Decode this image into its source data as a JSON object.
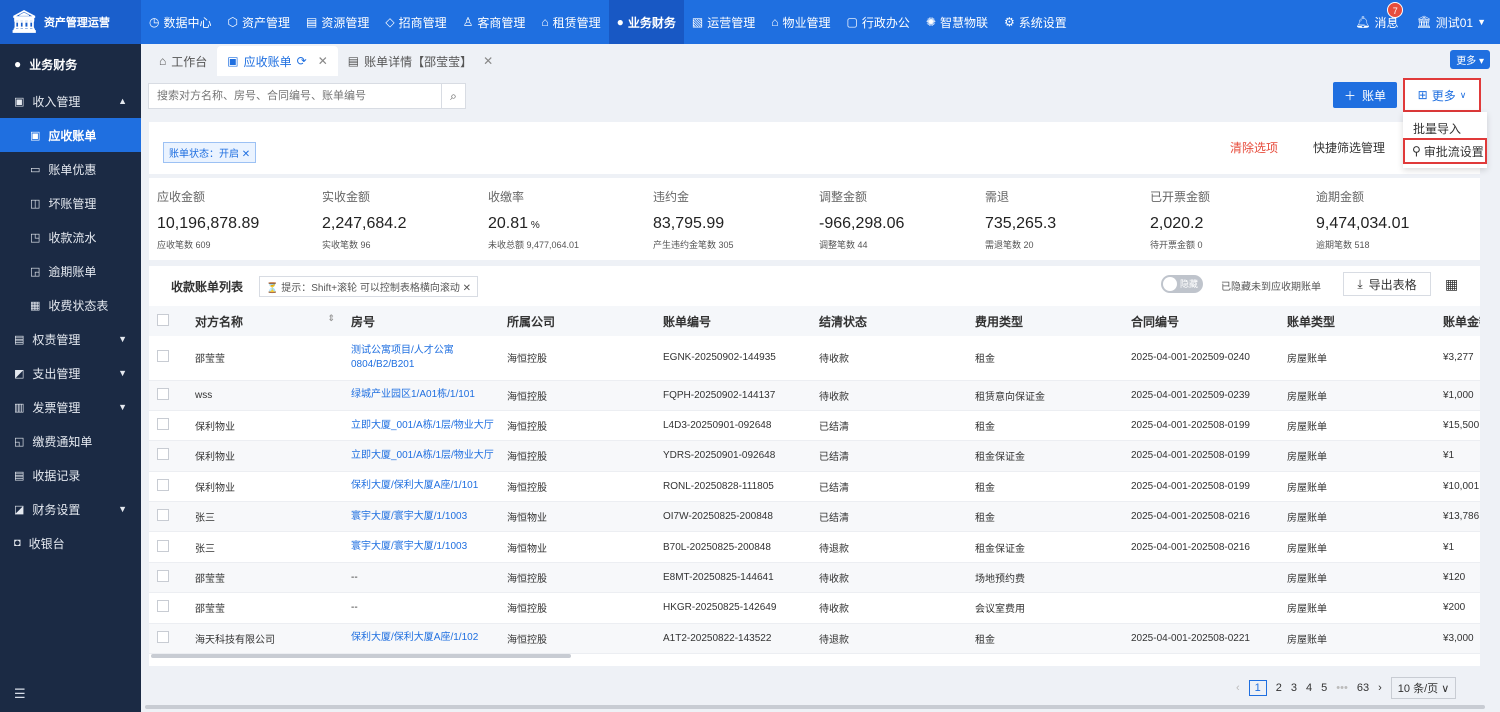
{
  "app": {
    "logo_icon": "bank-icon",
    "title": "资产管理运营"
  },
  "topnav": [
    {
      "icon": "◷",
      "label": "数据中心"
    },
    {
      "icon": "⬡",
      "label": "资产管理"
    },
    {
      "icon": "▤",
      "label": "资源管理"
    },
    {
      "icon": "◇",
      "label": "招商管理"
    },
    {
      "icon": "♙",
      "label": "客商管理"
    },
    {
      "icon": "⌂",
      "label": "租赁管理"
    },
    {
      "icon": "●",
      "label": "业务财务"
    },
    {
      "icon": "▧",
      "label": "运营管理"
    },
    {
      "icon": "⌂",
      "label": "物业管理"
    },
    {
      "icon": "▢",
      "label": "行政办公"
    },
    {
      "icon": "✺",
      "label": "智慧物联"
    },
    {
      "icon": "⚙",
      "label": "系统设置"
    }
  ],
  "user": {
    "msg_label": "消息",
    "msg_count": "7",
    "name": "测试01"
  },
  "sidebar": {
    "section": "业务财务",
    "income_group": "收入管理",
    "income_items": [
      {
        "icon": "▣",
        "label": "应收账单"
      },
      {
        "icon": "▭",
        "label": "账单优惠"
      },
      {
        "icon": "◫",
        "label": "坏账管理"
      },
      {
        "icon": "◳",
        "label": "收款流水"
      },
      {
        "icon": "◲",
        "label": "逾期账单"
      },
      {
        "icon": "▦",
        "label": "收费状态表"
      }
    ],
    "groups": [
      {
        "icon": "▤",
        "label": "权责管理",
        "chev": true
      },
      {
        "icon": "◩",
        "label": "支出管理",
        "chev": true
      },
      {
        "icon": "▥",
        "label": "发票管理",
        "chev": true
      },
      {
        "icon": "◱",
        "label": "缴费通知单",
        "chev": false
      },
      {
        "icon": "▤",
        "label": "收据记录",
        "chev": false
      },
      {
        "icon": "◪",
        "label": "财务设置",
        "chev": true
      },
      {
        "icon": "◘",
        "label": "收银台",
        "chev": false
      }
    ]
  },
  "tabs": [
    {
      "label": "工作台"
    },
    {
      "label": "应收账单"
    },
    {
      "label": "账单详情【邵莹莹】"
    }
  ],
  "more_top": "更多",
  "search": {
    "placeholder": "搜索对方名称、房号、合同编号、账单编号"
  },
  "toolbar": {
    "add_bill": "账单",
    "more": "更多"
  },
  "dropdown": {
    "item1": "批量导入",
    "item2": "审批流设置"
  },
  "filter": {
    "chip": "账单状态：开启",
    "clear": "清除选项",
    "quick": "快捷筛选管理"
  },
  "stats": [
    {
      "label": "应收金额",
      "value": "10,196,878.89",
      "unit": "",
      "sub": "应收笔数 609"
    },
    {
      "label": "实收金额",
      "value": "2,247,684.2",
      "unit": "",
      "sub": "实收笔数 96"
    },
    {
      "label": "收缴率",
      "value": "20.81",
      "unit": " %",
      "sub": "未收总额 9,477,064.01"
    },
    {
      "label": "违约金",
      "value": "83,795.99",
      "unit": "",
      "sub": "产生违约金笔数 305"
    },
    {
      "label": "调整金额",
      "value": "-966,298.06",
      "unit": "",
      "sub": "调整笔数 44"
    },
    {
      "label": "需退",
      "value": "735,265.3",
      "unit": "",
      "sub": "需退笔数 20"
    },
    {
      "label": "已开票金额",
      "value": "2,020.2",
      "unit": "",
      "sub": "待开票金额 0"
    },
    {
      "label": "逾期金额",
      "value": "9,474,034.01",
      "unit": "",
      "sub": "逾期笔数 518"
    }
  ],
  "list": {
    "title": "收款账单列表",
    "hint": "提示：Shift+滚轮 可以控制表格横向滚动",
    "toggle_label": "隐藏",
    "hide_text": "已隐藏未到应收期账单",
    "export": "导出表格"
  },
  "table": {
    "columns": [
      "对方名称",
      "房号",
      "所属公司",
      "账单编号",
      "结清状态",
      "费用类型",
      "合同编号",
      "账单类型",
      "账单金额"
    ],
    "rows": [
      [
        "邵莹莹",
        "测试公寓项目/人才公寓0804/B2/B201",
        "海恒控股",
        "EGNK-20250902-144935",
        "待收款",
        "租金",
        "2025-04-001-202509-0240",
        "房屋账单",
        "¥3,277"
      ],
      [
        "wss",
        "绿城产业园区1/A01栋/1/101",
        "海恒控股",
        "FQPH-20250902-144137",
        "待收款",
        "租赁意向保证金",
        "2025-04-001-202509-0239",
        "房屋账单",
        "¥1,000"
      ],
      [
        "保利物业",
        "立即大厦_001/A栋/1层/物业大厅",
        "海恒控股",
        "L4D3-20250901-092648",
        "已结清",
        "租金",
        "2025-04-001-202508-0199",
        "房屋账单",
        "¥15,500"
      ],
      [
        "保利物业",
        "立即大厦_001/A栋/1层/物业大厅",
        "海恒控股",
        "YDRS-20250901-092648",
        "已结清",
        "租金保证金",
        "2025-04-001-202508-0199",
        "房屋账单",
        "¥1"
      ],
      [
        "保利物业",
        "保利大厦/保利大厦A座/1/101",
        "海恒控股",
        "RONL-20250828-111805",
        "已结清",
        "租金",
        "2025-04-001-202508-0199",
        "房屋账单",
        "¥10,001"
      ],
      [
        "张三",
        "寰宇大厦/寰宇大厦/1/1003",
        "海恒物业",
        "OI7W-20250825-200848",
        "已结清",
        "租金",
        "2025-04-001-202508-0216",
        "房屋账单",
        "¥13,786"
      ],
      [
        "张三",
        "寰宇大厦/寰宇大厦/1/1003",
        "海恒物业",
        "B70L-20250825-200848",
        "待退款",
        "租金保证金",
        "2025-04-001-202508-0216",
        "房屋账单",
        "¥1"
      ],
      [
        "邵莹莹",
        "--",
        "海恒控股",
        "E8MT-20250825-144641",
        "待收款",
        "场地预约费",
        "",
        "房屋账单",
        "¥120"
      ],
      [
        "邵莹莹",
        "--",
        "海恒控股",
        "HKGR-20250825-142649",
        "待收款",
        "会议室费用",
        "",
        "房屋账单",
        "¥200"
      ],
      [
        "海天科技有限公司",
        "保利大厦/保利大厦A座/1/102",
        "海恒控股",
        "A1T2-20250822-143522",
        "待退款",
        "租金",
        "2025-04-001-202508-0221",
        "房屋账单",
        "¥3,000"
      ]
    ]
  },
  "pager": {
    "pages": [
      "1",
      "2",
      "3",
      "4",
      "5"
    ],
    "ellipsis": "•••",
    "last": "63",
    "size": "10 条/页"
  }
}
